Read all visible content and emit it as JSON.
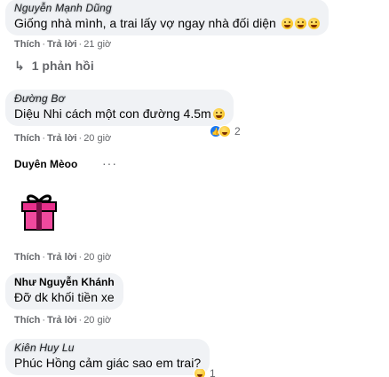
{
  "colors": {
    "link_gray": "#65676b",
    "bubble_bg": "#f0f2f5",
    "like_blue": "#1877f2"
  },
  "comments": [
    {
      "author": "Nguyễn Mạnh Dũng",
      "text": "Giống nhà mình, a trai lấy vợ ngay nhà đối diện",
      "text_emojis": [
        "rolling-on-floor-laughing-icon",
        "rolling-on-floor-laughing-icon",
        "rolling-on-floor-laughing-icon"
      ],
      "like_label": "Thích",
      "reply_label": "Trả lời",
      "time": "21 giờ",
      "replies_label": "1 phản hồi"
    },
    {
      "author": "Đường Bơ",
      "text": "Diệu Nhi cách một con đường 4.5m",
      "text_emojis": [
        "smiling-face-with-sweat-icon"
      ],
      "like_label": "Thích",
      "reply_label": "Trả lời",
      "time": "20 giờ",
      "reaction_count": "2"
    },
    {
      "author": "Duyên Mèoo",
      "more_label": "···",
      "sticker": "gift-box-sticker",
      "like_label": "Thích",
      "reply_label": "Trả lời",
      "time": "20 giờ"
    },
    {
      "author": "Như Nguyễn Khánh",
      "text": "Đỡ dk khối tiền xe",
      "like_label": "Thích",
      "reply_label": "Trả lời",
      "time": "20 giờ"
    },
    {
      "author": "Kiên Huy Lu",
      "text": "Phúc Hồng cảm giác sao em trai?",
      "reaction_count": "1"
    }
  ]
}
